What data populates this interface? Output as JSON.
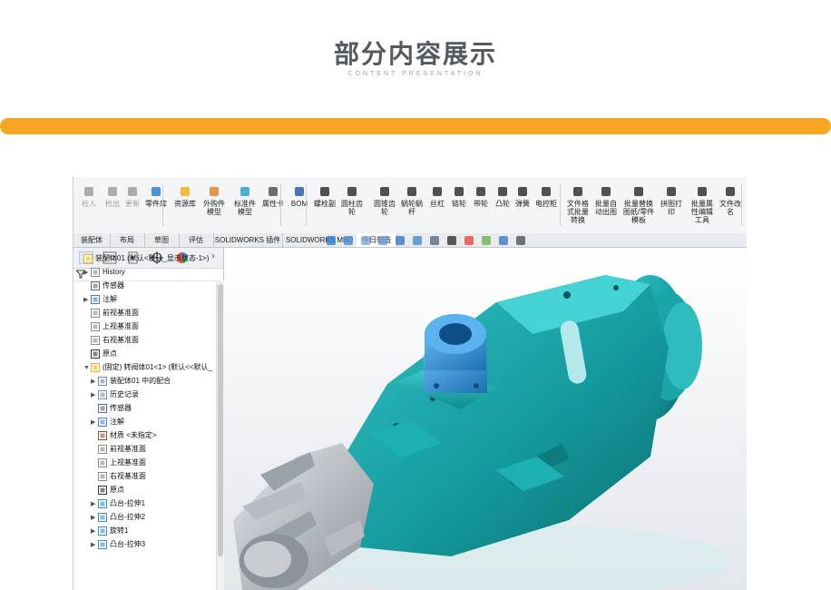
{
  "header": {
    "title": "部分内容展示",
    "subtitle": "CONTENT PRESENTATION"
  },
  "colors": {
    "accent_bar": "#f5a623",
    "model_teal": "#1aa6a6",
    "model_blue": "#2a8ad6"
  },
  "ribbon": {
    "buttons": [
      {
        "label": "检入",
        "icon": "checkin-icon",
        "dim": true
      },
      {
        "label": "检出",
        "icon": "checkout-icon",
        "dim": true
      },
      {
        "label": "更新",
        "icon": "refresh-icon",
        "dim": true
      },
      {
        "label": "零件库",
        "icon": "part-library-icon"
      },
      {
        "label": "资源库",
        "icon": "resource-library-icon"
      },
      {
        "label": "外购件模型",
        "icon": "purchased-part-icon"
      },
      {
        "label": "标准件模型",
        "icon": "standard-part-icon"
      },
      {
        "label": "属性卡",
        "icon": "property-card-icon"
      },
      {
        "label": "BOM",
        "icon": "bom-icon"
      },
      {
        "label": "螺栓副",
        "icon": "bolt-icon"
      },
      {
        "label": "圆柱齿轮",
        "icon": "spur-gear-icon"
      },
      {
        "label": "圆锥齿轮",
        "icon": "bevel-gear-icon"
      },
      {
        "label": "蜗轮蜗杆",
        "icon": "worm-gear-icon"
      },
      {
        "label": "丝杠",
        "icon": "lead-screw-icon"
      },
      {
        "label": "链轮",
        "icon": "sprocket-icon"
      },
      {
        "label": "带轮",
        "icon": "pulley-icon"
      },
      {
        "label": "凸轮",
        "icon": "cam-icon"
      },
      {
        "label": "弹簧",
        "icon": "spring-icon"
      },
      {
        "label": "电控柜",
        "icon": "control-cabinet-icon"
      },
      {
        "label": "文件格式批量转换",
        "icon": "batch-convert-icon"
      },
      {
        "label": "批量自动出图",
        "icon": "batch-drawing-icon"
      },
      {
        "label": "批量替换图纸/零件模板",
        "icon": "batch-template-icon"
      },
      {
        "label": "拼图打印",
        "icon": "print-icon"
      },
      {
        "label": "批量属性编辑工具",
        "icon": "batch-property-icon"
      },
      {
        "label": "文件改名",
        "icon": "rename-icon"
      }
    ]
  },
  "tabs": [
    "装配体",
    "布局",
    "草图",
    "评估",
    "SOLIDWORKS 插件",
    "SOLIDWORKS MBD",
    "今日制造"
  ],
  "active_tab": "今日制造",
  "tree": [
    {
      "label": "装配体01 (默认<默认_显示状态-1>)",
      "level": 0,
      "arrow": "",
      "icon": "assembly-icon"
    },
    {
      "label": "History",
      "level": 1,
      "arrow": "▶",
      "icon": "history-icon"
    },
    {
      "label": "传感器",
      "level": 1,
      "arrow": "",
      "icon": "sensor-icon"
    },
    {
      "label": "注解",
      "level": 1,
      "arrow": "▶",
      "icon": "annotation-icon"
    },
    {
      "label": "前视基准面",
      "level": 1,
      "arrow": "",
      "icon": "plane-icon"
    },
    {
      "label": "上视基准面",
      "level": 1,
      "arrow": "",
      "icon": "plane-icon"
    },
    {
      "label": "右视基准面",
      "level": 1,
      "arrow": "",
      "icon": "plane-icon"
    },
    {
      "label": "原点",
      "level": 1,
      "arrow": "",
      "icon": "origin-icon"
    },
    {
      "label": "(固定) 转阀体01<1> (默认<<默认_",
      "level": 1,
      "arrow": "▼",
      "icon": "part-icon"
    },
    {
      "label": "装配体01 中的配合",
      "level": 2,
      "arrow": "▶",
      "icon": "mate-icon"
    },
    {
      "label": "历史记录",
      "level": 2,
      "arrow": "▶",
      "icon": "history-icon"
    },
    {
      "label": "传感器",
      "level": 2,
      "arrow": "",
      "icon": "sensor-icon"
    },
    {
      "label": "注解",
      "level": 2,
      "arrow": "▶",
      "icon": "annotation-icon"
    },
    {
      "label": "材质 <未指定>",
      "level": 2,
      "arrow": "",
      "icon": "material-icon"
    },
    {
      "label": "前视基准面",
      "level": 2,
      "arrow": "",
      "icon": "plane-icon"
    },
    {
      "label": "上视基准面",
      "level": 2,
      "arrow": "",
      "icon": "plane-icon"
    },
    {
      "label": "右视基准面",
      "level": 2,
      "arrow": "",
      "icon": "plane-icon"
    },
    {
      "label": "原点",
      "level": 2,
      "arrow": "",
      "icon": "origin-icon"
    },
    {
      "label": "凸台-拉伸1",
      "level": 2,
      "arrow": "▶",
      "icon": "extrude-icon"
    },
    {
      "label": "凸台-拉伸2",
      "level": 2,
      "arrow": "▶",
      "icon": "extrude-icon"
    },
    {
      "label": "旋转1",
      "level": 2,
      "arrow": "▶",
      "icon": "revolve-icon"
    },
    {
      "label": "凸台-拉伸3",
      "level": 2,
      "arrow": "▶",
      "icon": "extrude-icon"
    }
  ]
}
